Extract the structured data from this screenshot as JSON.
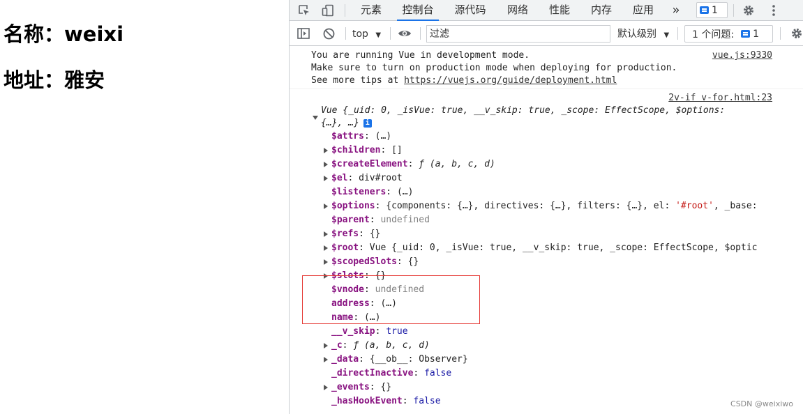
{
  "page": {
    "name_line": "名称：weixi",
    "address_line": "地址：雅安"
  },
  "devtools": {
    "tabs": [
      {
        "label": "元素"
      },
      {
        "label": "控制台"
      },
      {
        "label": "源代码"
      },
      {
        "label": "网络"
      },
      {
        "label": "性能"
      },
      {
        "label": "内存"
      },
      {
        "label": "应用"
      }
    ],
    "more_tabs": "»",
    "issues_badge_count": "1",
    "context_selector": "top",
    "filter_placeholder": "过滤",
    "log_level": "默认级别",
    "issues_label": "1 个问题:",
    "issues_count": "1",
    "accent_color": "#1a73e8"
  },
  "console": {
    "vue_msg": {
      "line1": "You are running Vue in development mode.",
      "line2": "Make sure to turn on production mode when deploying for production.",
      "line3_prefix": "See more tips at ",
      "line3_url": "https://vuejs.org/guide/deployment.html",
      "source": "vue.js:9330"
    },
    "log_source": "2v-if v-for.html:23",
    "vue_obj_line1": "Vue {_uid: 0, _isVue: true, __v_skip: true, _scope: EffectScope, $options:",
    "vue_obj_line2": "{…}, …}",
    "props": [
      {
        "key": "$attrs",
        "value": "(…)",
        "vtype": "obj",
        "expandable": false
      },
      {
        "key": "$children",
        "value": "[]",
        "vtype": "obj",
        "expandable": true
      },
      {
        "key": "$createElement",
        "value": "ƒ (a, b, c, d)",
        "vtype": "fn",
        "expandable": true
      },
      {
        "key": "$el",
        "value": "div#root",
        "vtype": "obj",
        "expandable": true
      },
      {
        "key": "$listeners",
        "value": "(…)",
        "vtype": "obj",
        "expandable": false
      },
      {
        "key": "$options",
        "value": "{components: {…}, directives: {…}, filters: {…}, el: '#root', _base:",
        "vtype": "obj",
        "expandable": true
      },
      {
        "key": "$parent",
        "value": "undefined",
        "vtype": "undef",
        "expandable": false
      },
      {
        "key": "$refs",
        "value": "{}",
        "vtype": "obj",
        "expandable": true
      },
      {
        "key": "$root",
        "value": "Vue {_uid: 0, _isVue: true, __v_skip: true, _scope: EffectScope, $optic",
        "vtype": "obj",
        "expandable": true
      },
      {
        "key": "$scopedSlots",
        "value": "{}",
        "vtype": "obj",
        "expandable": true
      },
      {
        "key": "$slots",
        "value": "{}",
        "vtype": "obj",
        "expandable": true
      },
      {
        "key": "$vnode",
        "value": "undefined",
        "vtype": "undef",
        "expandable": false
      },
      {
        "key": "address",
        "value": "(…)",
        "vtype": "obj",
        "expandable": false
      },
      {
        "key": "name",
        "value": "(…)",
        "vtype": "obj",
        "expandable": false
      },
      {
        "key": "__v_skip",
        "value": "true",
        "vtype": "bool",
        "expandable": false
      },
      {
        "key": "_c",
        "value": "ƒ (a, b, c, d)",
        "vtype": "fn",
        "expandable": true
      },
      {
        "key": "_data",
        "value": "{__ob__: Observer}",
        "vtype": "obj",
        "expandable": true
      },
      {
        "key": "_directInactive",
        "value": "false",
        "vtype": "bool",
        "expandable": false
      },
      {
        "key": "_events",
        "value": "{}",
        "vtype": "obj",
        "expandable": true
      },
      {
        "key": "_hasHookEvent",
        "value": "false",
        "vtype": "bool",
        "expandable": false
      }
    ]
  },
  "watermark": "CSDN @weixiwo"
}
